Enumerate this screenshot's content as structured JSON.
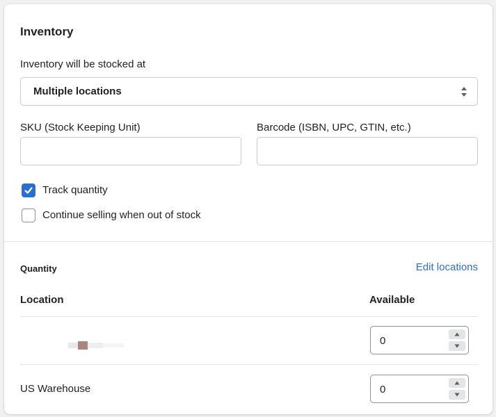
{
  "inventory": {
    "title": "Inventory",
    "stocked_at_label": "Inventory will be stocked at",
    "stocked_at_value": "Multiple locations",
    "sku_label": "SKU (Stock Keeping Unit)",
    "sku_value": "",
    "barcode_label": "Barcode (ISBN, UPC, GTIN, etc.)",
    "barcode_value": "",
    "track_quantity_label": "Track quantity",
    "track_quantity_checked": true,
    "continue_selling_label": "Continue selling when out of stock",
    "continue_selling_checked": false
  },
  "quantity": {
    "heading": "Quantity",
    "edit_locations_label": "Edit locations",
    "col_location": "Location",
    "col_available": "Available",
    "rows": [
      {
        "location": "",
        "available": "0"
      },
      {
        "location": "US Warehouse",
        "available": "0"
      }
    ]
  },
  "colors": {
    "accent": "#2c6ecb",
    "border": "#c9cccf",
    "text": "#202223"
  }
}
